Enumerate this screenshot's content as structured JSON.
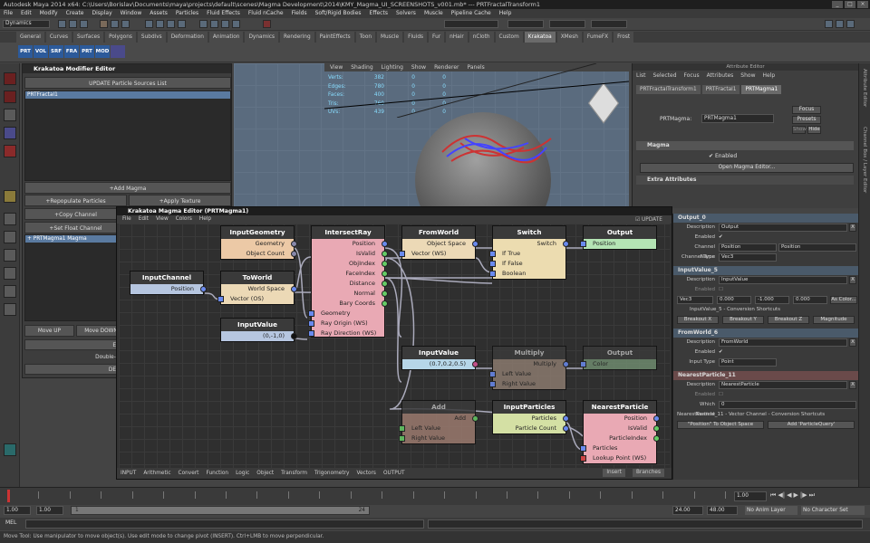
{
  "window": {
    "title": "Autodesk Maya 2014 x64: C:\\Users\\Borislav\\Documents\\maya\\projects\\default\\scenes\\Magma Development\\2014\\KMY_Magma_UI_SCREENSHOTS_v001.mb* --- PRTFractalTransform1"
  },
  "menubar": [
    "File",
    "Edit",
    "Modify",
    "Create",
    "Display",
    "Window",
    "Assets",
    "Particles",
    "Fluid Effects",
    "Fluid nCache",
    "Fields",
    "Soft/Rigid Bodies",
    "Effects",
    "Solvers",
    "Muscle",
    "Pipeline Cache",
    "Help"
  ],
  "status_line": {
    "mode": "Dynamics"
  },
  "shelf_tabs": [
    "General",
    "Curves",
    "Surfaces",
    "Polygons",
    "Subdivs",
    "Deformation",
    "Animation",
    "Dynamics",
    "Rendering",
    "PaintEffects",
    "Toon",
    "Muscle",
    "Fluids",
    "Fur",
    "nHair",
    "nCloth",
    "Custom",
    "Krakatoa",
    "XMesh",
    "FumeFX",
    "Frost"
  ],
  "active_shelf_tab": "Krakatoa",
  "shelf_icons": [
    "PRT",
    "VOL",
    "SRF",
    "FRA",
    "PRT",
    "MOD"
  ],
  "viewport": {
    "menu": [
      "View",
      "Shading",
      "Lighting",
      "Show",
      "Renderer",
      "Panels"
    ],
    "stats": [
      {
        "label": "Verts:",
        "v1": "382",
        "v2": "0",
        "v3": "0"
      },
      {
        "label": "Edges:",
        "v1": "780",
        "v2": "0",
        "v3": "0"
      },
      {
        "label": "Faces:",
        "v1": "400",
        "v2": "0",
        "v3": "0"
      },
      {
        "label": "Tris:",
        "v1": "760",
        "v2": "0",
        "v3": "0"
      },
      {
        "label": "UVs:",
        "v1": "439",
        "v2": "0",
        "v3": "0"
      }
    ]
  },
  "modifier_editor": {
    "title": "Krakatoa Modifier Editor",
    "update_button": "UPDATE Particle Sources List",
    "selected_source": "PRTFractal1",
    "add_magma": "+Add Magma",
    "repopulate": "+Repopulate Particles",
    "apply_texture": "+Apply Texture",
    "copy_channel": "+Copy Channel",
    "set_float": "+Set Float Channel",
    "stack_item": "+ PRTMagma1 Magma",
    "move_up": "Move UP",
    "move_down": "Move DOWN",
    "button_e": "E",
    "hint": "Double-click a Modifier o",
    "button_de": "DE"
  },
  "attribute_editor": {
    "header": "Attribute Editor",
    "menu": [
      "List",
      "Selected",
      "Focus",
      "Attributes",
      "Show",
      "Help"
    ],
    "tabs": [
      "PRTFractalTransform1",
      "PRTFractal1",
      "PRTMagma1"
    ],
    "active_tab": "PRTMagma1",
    "node_label": "PRTMagma:",
    "node_value": "PRTMagma1",
    "focus": "Focus",
    "presets": "Presets",
    "show": "Show",
    "hide": "Hide",
    "section_magma": "Magma",
    "enabled": "Enabled",
    "open_button": "Open Magma Editor...",
    "section_extra": "Extra Attributes"
  },
  "sidebar_labels": [
    "Attribute Editor",
    "Channel Box / Layer Editor"
  ],
  "graph_editor": {
    "title": "Krakatoa Magma Editor (PRTMagma1)",
    "menu": [
      "File",
      "Edit",
      "View",
      "Colors",
      "Help"
    ],
    "update": "UPDATE",
    "footer": [
      "INPUT",
      "Arithmetic",
      "Convert",
      "Function",
      "Logic",
      "Object",
      "Transform",
      "Trigonometry",
      "Vectors",
      "OUTPUT"
    ],
    "insert": "Insert",
    "branches": "Branches",
    "nodes": {
      "inputgeometry": {
        "title": "InputGeometry",
        "out1": "Geometry",
        "out2": "Object Count"
      },
      "intersectray": {
        "title": "IntersectRay",
        "o1": "Position",
        "o2": "IsValid",
        "o3": "ObjIndex",
        "o4": "FaceIndex",
        "o5": "Distance",
        "o6": "Normal",
        "o7": "Bary Coords",
        "i1": "Geometry",
        "i2": "Ray Origin (WS)",
        "i3": "Ray Direction (WS)"
      },
      "fromworld": {
        "title": "FromWorld",
        "out": "Object Space",
        "in": "Vector (WS)"
      },
      "switch": {
        "title": "Switch",
        "out": "Switch",
        "i1": "If True",
        "i2": "If False",
        "i3": "Boolean"
      },
      "output": {
        "title": "Output",
        "in": "Position"
      },
      "inputchannel": {
        "title": "InputChannel",
        "out": "Position"
      },
      "toworld": {
        "title": "ToWorld",
        "out": "World Space",
        "in": "Vector (OS)"
      },
      "inputvalue1": {
        "title": "InputValue",
        "value": "(0,-1,0)"
      },
      "inputvalue2": {
        "title": "InputValue",
        "value": "(0.7,0.2,0.5)"
      },
      "multiply": {
        "title": "Multiply",
        "out": "Multiply",
        "i1": "Left Value",
        "i2": "Right Value"
      },
      "output2": {
        "title": "Output",
        "in": "Color"
      },
      "add": {
        "title": "Add",
        "out": "Add",
        "i1": "Left Value",
        "i2": "Right Value"
      },
      "inputparticles": {
        "title": "InputParticles",
        "o1": "Particles",
        "o2": "Particle Count"
      },
      "nearestparticle": {
        "title": "NearestParticle",
        "o1": "Position",
        "o2": "IsValid",
        "o3": "ParticleIndex",
        "i1": "Particles",
        "i2": "Lookup Point (WS)"
      }
    }
  },
  "properties": {
    "s1": {
      "title": "Output_0",
      "desc_label": "Description",
      "desc": "Output",
      "enabled": "Enabled",
      "chan_label": "Channel Name",
      "chan": "Position",
      "chan2": "Position",
      "type_label": "Channel Type",
      "type": "Vec3"
    },
    "s2": {
      "title": "InputValue_5",
      "desc_label": "Description",
      "desc": "InputValue",
      "enabled": "Enabled",
      "vtype": "Vec3",
      "x": "0.000",
      "y": "-1.000",
      "z": "0.000",
      "ascolor": "As Color...",
      "shortcuts": "InputValue_5 - Conversion Shortcuts",
      "bx": "Breakout X",
      "by": "Breakout Y",
      "bz": "Breakout Z",
      "mag": "Magnitude"
    },
    "s3": {
      "title": "FromWorld_6",
      "desc_label": "Description",
      "desc": "FromWorld",
      "enabled": "Enabled",
      "itype_label": "Input Type",
      "itype": "Point"
    },
    "s4": {
      "title": "NearestParticle_11",
      "desc_label": "Description",
      "desc": "NearestParticle",
      "enabled": "Enabled",
      "which_label": "Which Nearest",
      "which": "0",
      "shortcuts": "NearestParticle_11 - Vector Channel - Conversion Shortcuts",
      "b1": "\"Position\" To Object Space",
      "b2": "Add 'ParticleQuery'"
    }
  },
  "timeline": {
    "start": "1.00",
    "end": "24.00",
    "rstart": "1.00",
    "rend": "1",
    "rcur": "24",
    "range_end": "48.00",
    "current": "1.00",
    "anim_layer": "No Anim Layer",
    "char_set": "No Character Set",
    "ticks": [
      "1",
      "2",
      "3",
      "4",
      "5",
      "6",
      "7",
      "8",
      "9",
      "10",
      "11",
      "12",
      "13",
      "14",
      "15",
      "16",
      "17",
      "18",
      "19",
      "20",
      "21",
      "22",
      "23",
      "24"
    ]
  },
  "cmd": {
    "label": "MEL"
  },
  "help_line": "Move Tool: Use manipulator to move object(s). Use edit mode to change pivot (INSERT). Ctrl+LMB to move perpendicular."
}
